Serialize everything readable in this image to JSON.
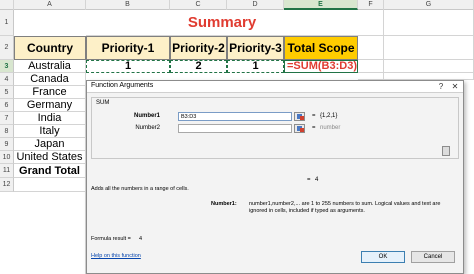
{
  "sheet": {
    "columns": [
      "A",
      "B",
      "C",
      "D",
      "E",
      "F",
      "G"
    ],
    "active_column": "E",
    "rows": [
      "1",
      "2",
      "3",
      "4",
      "5",
      "6",
      "7",
      "8",
      "9",
      "10",
      "11",
      "12"
    ],
    "active_row": "3",
    "title": "Summary",
    "headers": {
      "country": "Country",
      "p1": "Priority-1",
      "p2": "Priority-2",
      "p3": "Priority-3",
      "total": "Total Scope"
    },
    "countries": [
      "Australia",
      "Canada",
      "France",
      "Germany",
      "India",
      "Italy",
      "Japan",
      "United States"
    ],
    "row3_values": [
      "1",
      "2",
      "1"
    ],
    "grand_total": "Grand Total",
    "formula": "=SUM(B3:D3)"
  },
  "dialog": {
    "title": "Function Arguments",
    "help_icon": "question-icon",
    "close_icon": "close-icon",
    "function_name": "SUM",
    "number1_label": "Number1",
    "number1_value": "B3:D3",
    "number1_result": "{1,2,1}",
    "number2_label": "Number2",
    "number2_value": "",
    "number2_result": "number",
    "equals": "=",
    "total_result": "4",
    "description": "Adds all the numbers in a range of cells.",
    "arg_desc_label": "Number1:",
    "arg_desc_text": "number1,number2,... are 1 to 255 numbers to sum. Logical values and text are ignored in cells, included if typed as arguments.",
    "formula_result_label": "Formula result =",
    "formula_result_value": "4",
    "help_link": "Help on this function",
    "ok_label": "OK",
    "cancel_label": "Cancel",
    "colors": {
      "title_red": "#e03c31",
      "header_cream": "#fdf0c8",
      "header_yellow": "#ffcc00",
      "excel_green": "#217346"
    }
  }
}
